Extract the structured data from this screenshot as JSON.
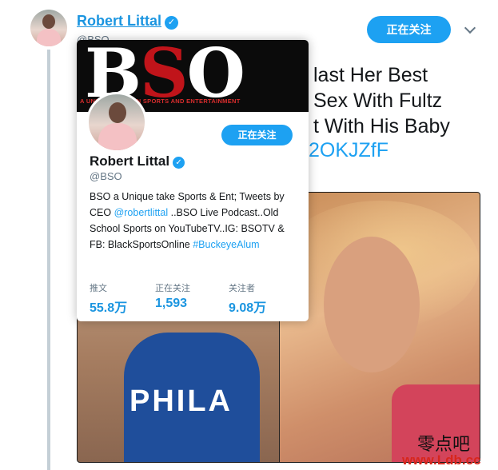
{
  "tweet": {
    "author_name": "Robert Littal",
    "author_handle": "@BSO",
    "follow_label": "正在关注",
    "text_lines": "last Her Best\nSex With Fultz\nt With His Baby",
    "link_fragment": "2OKJZfF",
    "verified_mark": "✓"
  },
  "hover_card": {
    "banner_logo_b": "B",
    "banner_logo_s": "S",
    "banner_logo_o": "O",
    "banner_tagline": "A UNIQUE TAKE ON SPORTS AND ENTERTAINMENT",
    "name": "Robert Littal",
    "handle": "@BSO",
    "follow_label": "正在关注",
    "bio_part1": "BSO a Unique take Sports & Ent; Tweets by CEO ",
    "bio_mention": "@robertlittal",
    "bio_part2": " ..BSO Live Podcast..Old School Sports on YouTubeTV..IG: BSOTV & FB: BlackSportsOnline ",
    "bio_hashtag": "#BuckeyeAlum",
    "stats": [
      {
        "label": "推文",
        "value": "55.8万"
      },
      {
        "label": "正在关注",
        "value": "1,593"
      },
      {
        "label": "关注者",
        "value": "9.08万"
      }
    ]
  },
  "media": {
    "jersey_text": "PHILA"
  },
  "watermark": {
    "cn": "零点吧",
    "url": "www.Ldb.cc"
  }
}
